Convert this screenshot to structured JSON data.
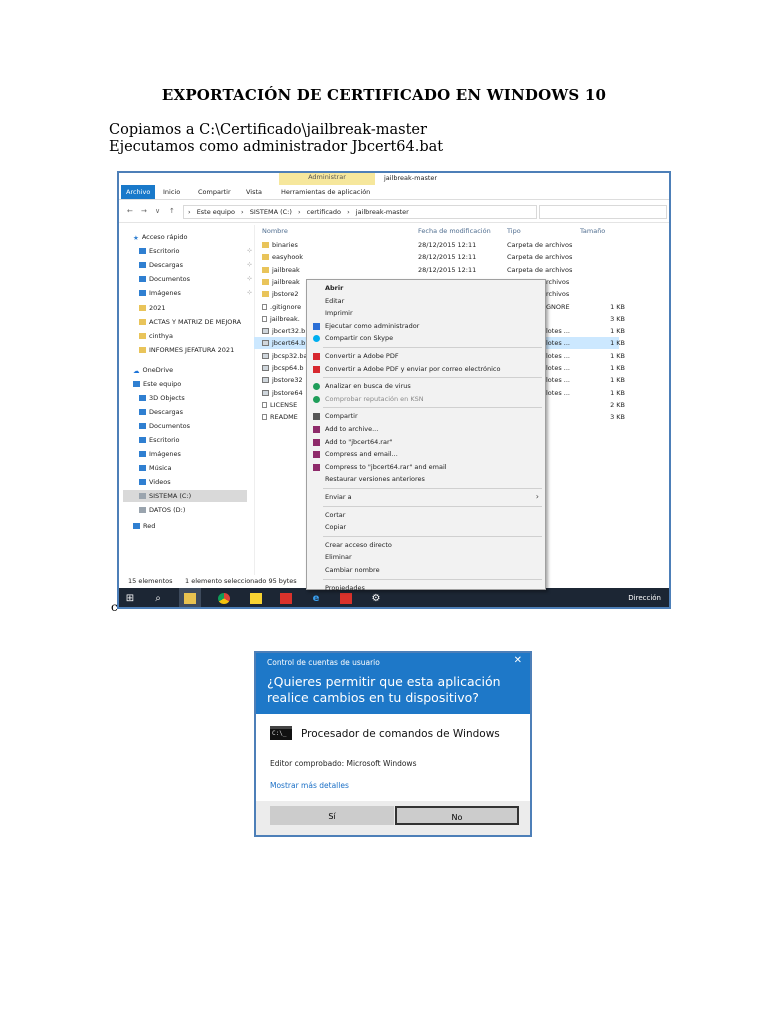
{
  "document": {
    "title": "EXPORTACIÓN DE CERTIFICADO EN WINDOWS 10",
    "line1": "Copiamos a C:\\Certificado\\jailbreak-master",
    "line2": "Ejecutamos como administrador Jbcert64.bat",
    "stray": "c"
  },
  "explorer": {
    "context_tab": "Administrar",
    "window_title": "jailbreak-master",
    "ribbon_tabs": [
      "Archivo",
      "Inicio",
      "Compartir",
      "Vista",
      "Herramientas de aplicación"
    ],
    "breadcrumb": [
      "Este equipo",
      "SISTEMA (C:)",
      "certificado",
      "jailbreak-master"
    ],
    "nav_glyphs": [
      "←",
      "→",
      "∨",
      "↑"
    ],
    "nav": [
      {
        "label": "Acceso rápido",
        "icon": "star"
      },
      {
        "label": "Escritorio",
        "icon": "blue",
        "pin": "📌"
      },
      {
        "label": "Descargas",
        "icon": "blue",
        "pin": "📌"
      },
      {
        "label": "Documentos",
        "icon": "blue",
        "pin": "📌"
      },
      {
        "label": "Imágenes",
        "icon": "blue",
        "pin": "📌"
      },
      {
        "label": "2021",
        "icon": "folder"
      },
      {
        "label": "ACTAS Y MATRIZ DE MEJORA",
        "icon": "folder"
      },
      {
        "label": "cinthya",
        "icon": "folder"
      },
      {
        "label": "INFORMES JEFATURA  2021",
        "icon": "folder"
      },
      {
        "label": "OneDrive",
        "icon": "cloud"
      },
      {
        "label": "Este equipo",
        "icon": "blue"
      },
      {
        "label": "3D Objects",
        "icon": "blue"
      },
      {
        "label": "Descargas",
        "icon": "blue"
      },
      {
        "label": "Documentos",
        "icon": "blue"
      },
      {
        "label": "Escritorio",
        "icon": "blue"
      },
      {
        "label": "Imágenes",
        "icon": "blue"
      },
      {
        "label": "Música",
        "icon": "blue"
      },
      {
        "label": "Videos",
        "icon": "blue"
      },
      {
        "label": "SISTEMA (C:)",
        "icon": "drive"
      },
      {
        "label": "DATOS (D:)",
        "icon": "drive"
      },
      {
        "label": "Red",
        "icon": "blue"
      }
    ],
    "columns": {
      "name": "Nombre",
      "date": "Fecha de modificación",
      "type": "Tipo",
      "size": "Tamaño"
    },
    "files": [
      {
        "name": "binaries",
        "icon": "folder",
        "date": "28/12/2015 12:11",
        "type": "Carpeta de archivos",
        "size": ""
      },
      {
        "name": "easyhook",
        "icon": "folder",
        "date": "28/12/2015 12:11",
        "type": "Carpeta de archivos",
        "size": ""
      },
      {
        "name": "jailbreak",
        "icon": "folder",
        "date": "28/12/2015 12:11",
        "type": "Carpeta de archivos",
        "size": ""
      },
      {
        "name": "jailbreak",
        "icon": "folder",
        "date": "",
        "type": "rchivos",
        "size": ""
      },
      {
        "name": "jbstore2",
        "icon": "folder",
        "date": "",
        "type": "rchivos",
        "size": ""
      },
      {
        "name": ".gitignore",
        "icon": "file",
        "date": "",
        "type": "GNORE",
        "size": "1 KB"
      },
      {
        "name": "jailbreak.",
        "icon": "file",
        "date": "",
        "type": "",
        "size": "3 KB"
      },
      {
        "name": "jbcert32.b",
        "icon": "bat",
        "date": "",
        "type": "lotes ...",
        "size": "1 KB"
      },
      {
        "name": "jbcert64.b",
        "icon": "bat",
        "date": "",
        "type": "lotes ...",
        "size": "1 KB",
        "selected": true
      },
      {
        "name": "jbcsp32.ba",
        "icon": "bat",
        "date": "",
        "type": "lotes ...",
        "size": "1 KB"
      },
      {
        "name": "jbcsp64.b",
        "icon": "bat",
        "date": "",
        "type": "lotes ...",
        "size": "1 KB"
      },
      {
        "name": "jbstore32",
        "icon": "bat",
        "date": "",
        "type": "lotes ...",
        "size": "1 KB"
      },
      {
        "name": "jbstore64",
        "icon": "bat",
        "date": "",
        "type": "lotes ...",
        "size": "1 KB"
      },
      {
        "name": "LICENSE",
        "icon": "file",
        "date": "",
        "type": "",
        "size": "2 KB"
      },
      {
        "name": "README",
        "icon": "file",
        "date": "",
        "type": "",
        "size": "3 KB"
      }
    ],
    "status": [
      "15 elementos",
      "1 elemento seleccionado  95 bytes"
    ],
    "taskbar_right": "Dirección",
    "context_menu": [
      {
        "label": "Abrir",
        "bold": true
      },
      {
        "label": "Editar"
      },
      {
        "label": "Imprimir"
      },
      {
        "label": "Ejecutar como administrador",
        "icon": "shield"
      },
      {
        "label": "Compartir con Skype",
        "icon": "skype"
      },
      {
        "sep": true
      },
      {
        "label": "Convertir a Adobe PDF",
        "icon": "pdf"
      },
      {
        "label": "Convertir a Adobe PDF y enviar por correo electrónico",
        "icon": "pdf"
      },
      {
        "sep": true
      },
      {
        "label": "Analizar en busca de virus",
        "icon": "kaspersky"
      },
      {
        "label": "Comprobar reputación en KSN",
        "icon": "kaspersky",
        "disabled": true
      },
      {
        "sep": true
      },
      {
        "label": "Compartir",
        "icon": "share"
      },
      {
        "label": "Add to archive...",
        "icon": "winrar"
      },
      {
        "label": "Add to \"jbcert64.rar\"",
        "icon": "winrar"
      },
      {
        "label": "Compress and email...",
        "icon": "winrar"
      },
      {
        "label": "Compress to \"jbcert64.rar\" and email",
        "icon": "winrar"
      },
      {
        "label": "Restaurar versiones anteriores"
      },
      {
        "sep": true
      },
      {
        "label": "Enviar a",
        "submenu": true
      },
      {
        "sep": true
      },
      {
        "label": "Cortar"
      },
      {
        "label": "Copiar"
      },
      {
        "sep": true
      },
      {
        "label": "Crear acceso directo"
      },
      {
        "label": "Eliminar"
      },
      {
        "label": "Cambiar nombre"
      },
      {
        "sep": true
      },
      {
        "label": "Propiedades"
      }
    ]
  },
  "uac": {
    "caption": "Control de cuentas de usuario",
    "close": "✕",
    "question": "¿Quieres permitir que esta aplicación realice cambios en tu dispositivo?",
    "app_name": "Procesador de comandos de Windows",
    "cmd_glyph": "C:\\_",
    "publisher": "Editor comprobado: Microsoft Windows",
    "more": "Mostrar más detalles",
    "yes": "Sí",
    "no": "No"
  }
}
